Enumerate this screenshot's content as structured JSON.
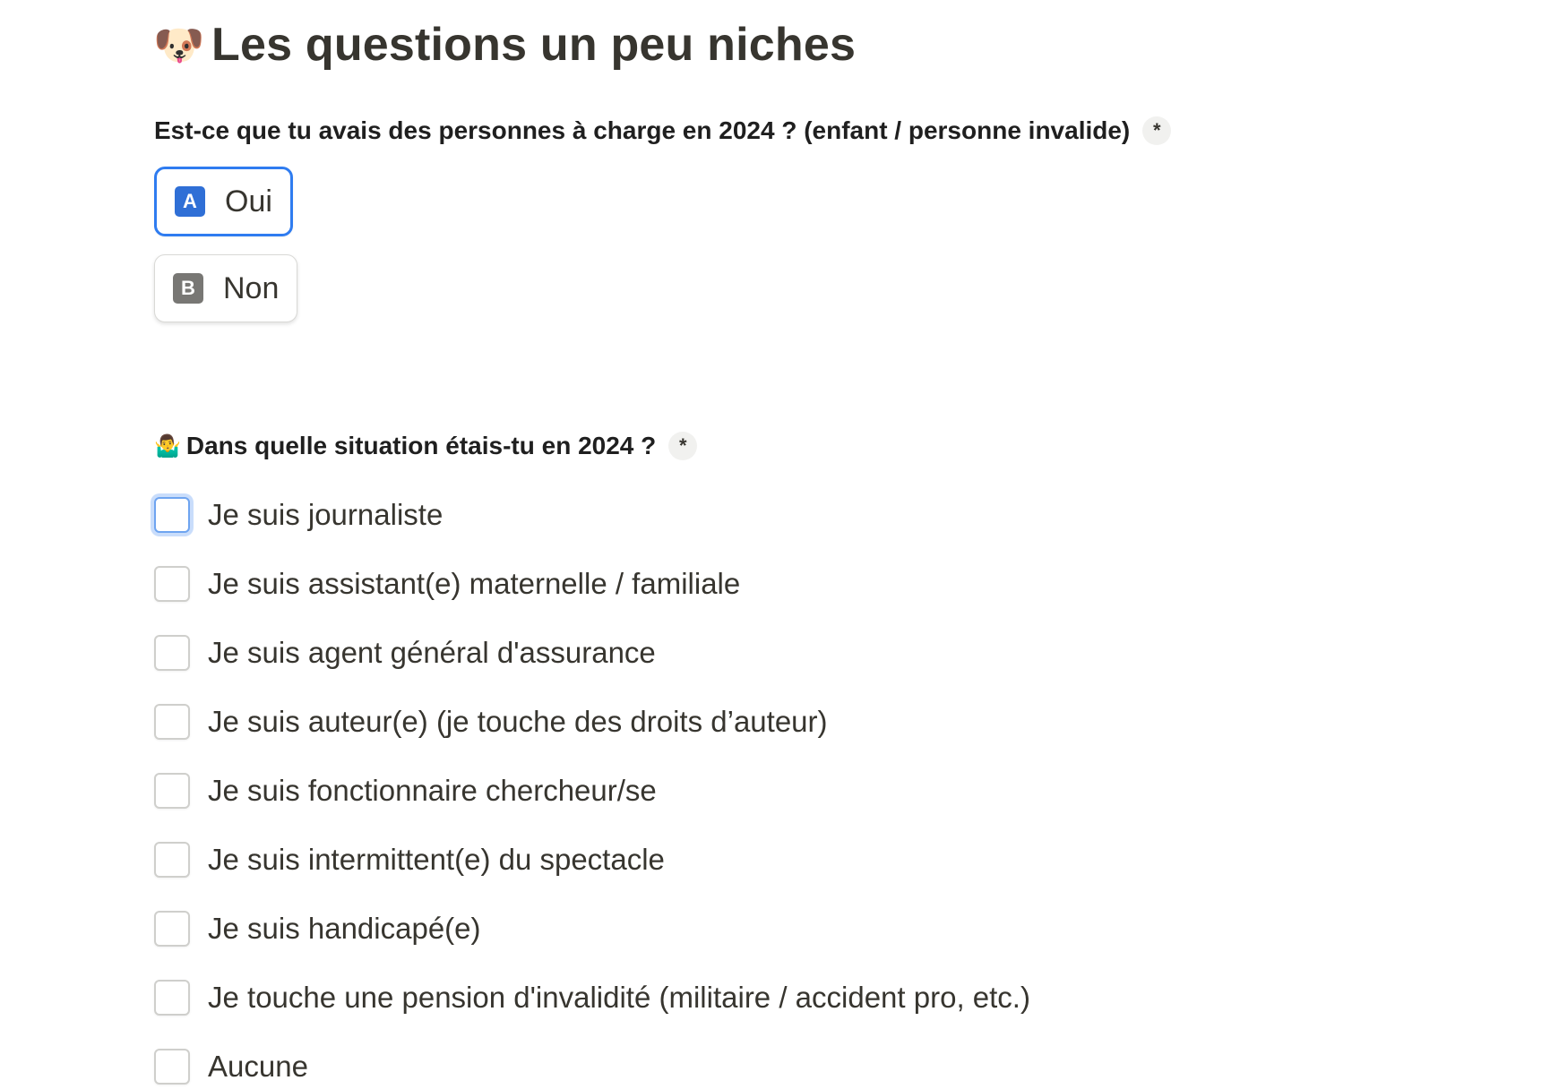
{
  "page": {
    "title": "Les questions un peu niches",
    "title_emoji": "🐶"
  },
  "question1": {
    "label": "Est-ce que tu avais des personnes à charge en 2024 ? (enfant / personne invalide)",
    "required_marker": "*",
    "options": [
      {
        "key": "A",
        "label": "Oui",
        "selected": true
      },
      {
        "key": "B",
        "label": "Non",
        "selected": false
      }
    ]
  },
  "question2": {
    "emoji": "🤷‍♂️",
    "label": "Dans quelle situation étais-tu en 2024 ?",
    "required_marker": "*",
    "options": [
      {
        "label": "Je suis journaliste",
        "checked": false,
        "focused": true
      },
      {
        "label": "Je suis assistant(e) maternelle / familiale",
        "checked": false
      },
      {
        "label": "Je suis agent général d'assurance",
        "checked": false
      },
      {
        "label": "Je suis auteur(e) (je touche des droits d’auteur)",
        "checked": false
      },
      {
        "label": "Je suis fonctionnaire chercheur/se",
        "checked": false
      },
      {
        "label": "Je suis intermittent(e) du spectacle",
        "checked": false
      },
      {
        "label": "Je suis handicapé(e)",
        "checked": false
      },
      {
        "label": "Je touche une pension d'invalidité (militaire / accident pro, etc.)",
        "checked": false
      },
      {
        "label": "Aucune",
        "checked": false
      }
    ]
  },
  "colors": {
    "accent": "#2f7cf0",
    "key_a": "#2f6fd6",
    "key_b": "#787774",
    "text": "#37352f"
  }
}
